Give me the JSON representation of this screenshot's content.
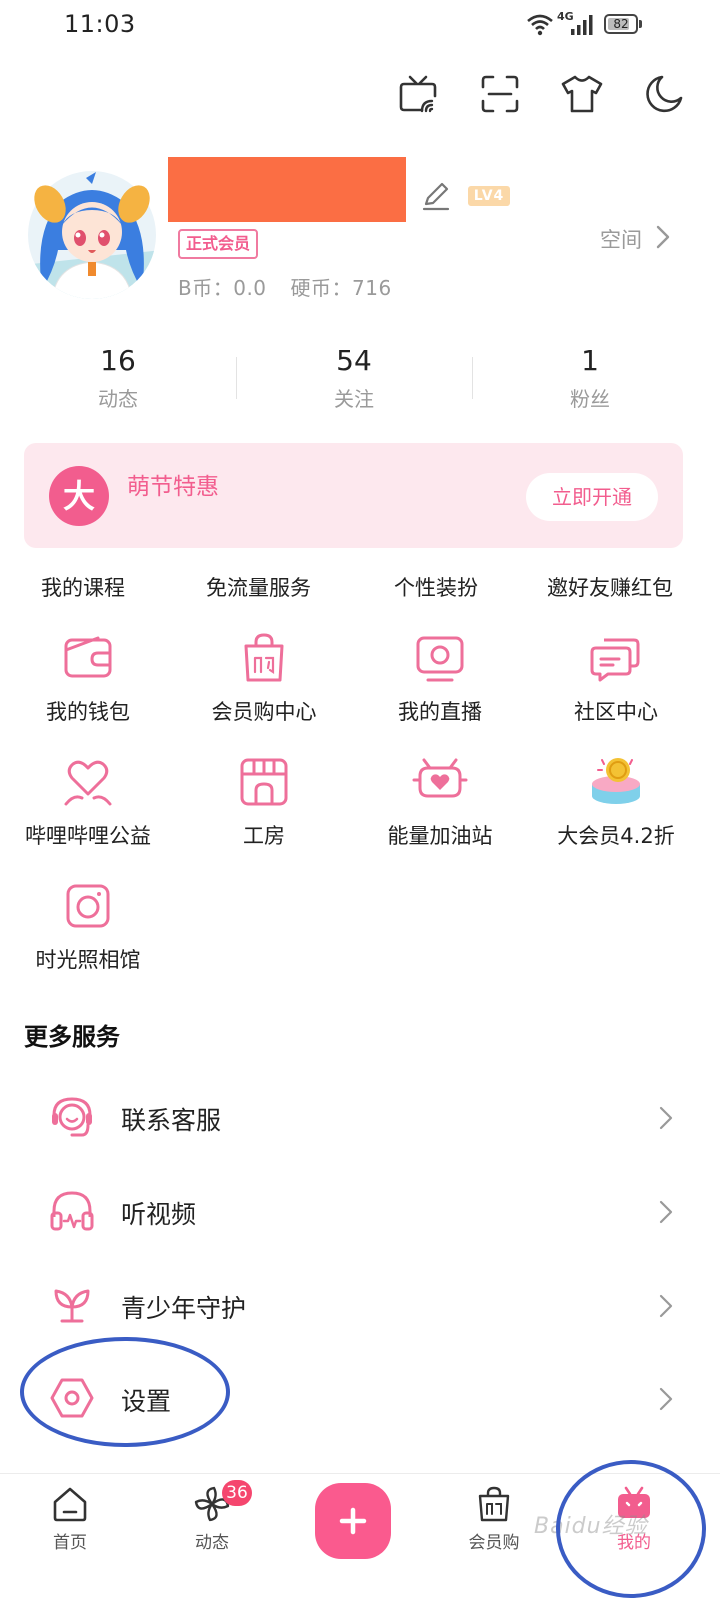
{
  "status_bar": {
    "time": "11:03",
    "network": "4G",
    "battery": "82",
    "battery_level": 0.82
  },
  "toolbar": {
    "icons": [
      "tv-cast-icon",
      "scan-icon",
      "shirt-icon",
      "moon-icon"
    ]
  },
  "profile": {
    "level": "LV4",
    "member_badge": "正式会员",
    "b_coin": "B币：0.0",
    "hard_coin": "硬币：716",
    "space_link": "空间"
  },
  "stats": [
    {
      "value": "16",
      "label": "动态"
    },
    {
      "value": "54",
      "label": "关注"
    },
    {
      "value": "1",
      "label": "粉丝"
    }
  ],
  "vip": {
    "badge": "大",
    "title": "萌节特惠",
    "button": "立即开通"
  },
  "quick_links": [
    "我的课程",
    "免流量服务",
    "个性装扮",
    "邀好友赚红包"
  ],
  "grid": [
    {
      "label": "我的钱包",
      "icon": "wallet-icon"
    },
    {
      "label": "会员购中心",
      "icon": "shopping-bag-icon"
    },
    {
      "label": "我的直播",
      "icon": "live-tv-icon"
    },
    {
      "label": "社区中心",
      "icon": "chat-icon"
    },
    {
      "label": "哔哩哔哩公益",
      "icon": "heart-hands-icon"
    },
    {
      "label": "工房",
      "icon": "store-icon"
    },
    {
      "label": "能量加油站",
      "icon": "energy-heart-icon"
    },
    {
      "label": "大会员4.2折",
      "icon": "cake-icon"
    },
    {
      "label": "时光照相馆",
      "icon": "camera-icon"
    }
  ],
  "more_services": {
    "title": "更多服务",
    "items": [
      {
        "label": "联系客服",
        "icon": "headset-icon"
      },
      {
        "label": "听视频",
        "icon": "headphones-icon"
      },
      {
        "label": "青少年守护",
        "icon": "sprout-icon"
      },
      {
        "label": "设置",
        "icon": "gear-icon"
      }
    ]
  },
  "bottom_nav": {
    "items": [
      {
        "label": "首页",
        "icon": "home-icon"
      },
      {
        "label": "动态",
        "icon": "pinwheel-icon",
        "badge": "36"
      },
      {
        "label": "",
        "icon": "plus-icon"
      },
      {
        "label": "会员购",
        "icon": "shopping-bag-icon"
      },
      {
        "label": "我的",
        "icon": "tv-mascot-icon",
        "active": true
      }
    ]
  },
  "watermark": "Baidu经验",
  "colors": {
    "accent": "#f25d8e",
    "annotation": "#3a5cc4",
    "redaction": "#fb6e44"
  }
}
